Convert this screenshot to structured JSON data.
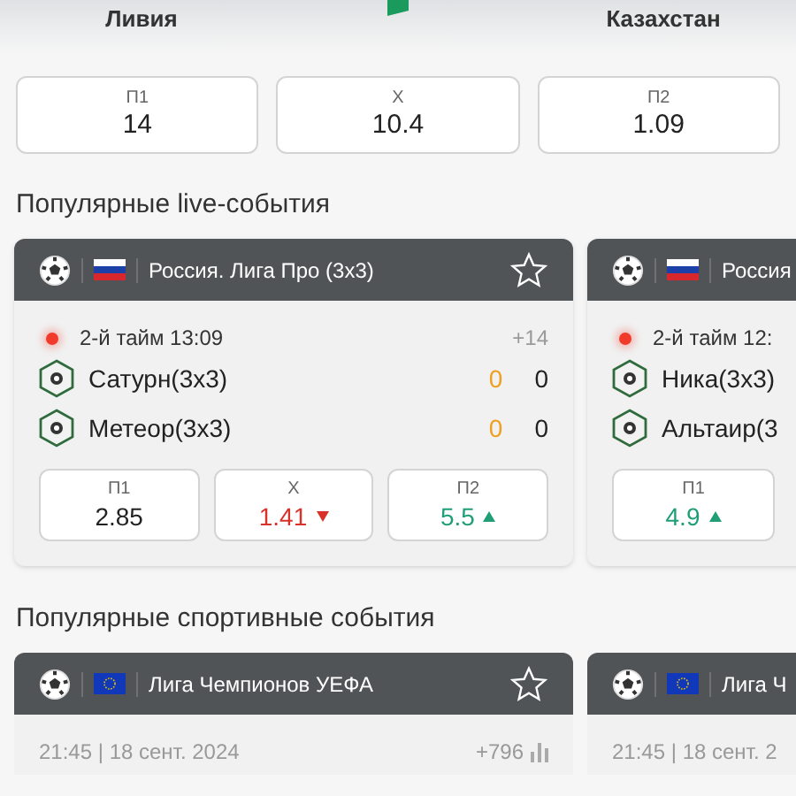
{
  "match": {
    "team1": "Ливия",
    "team2": "Казахстан",
    "odds": [
      {
        "label": "П1",
        "value": "14",
        "up": false,
        "down": false
      },
      {
        "label": "Х",
        "value": "10.4",
        "up": false,
        "down": false
      },
      {
        "label": "П2",
        "value": "1.09",
        "up": false,
        "down": false
      }
    ]
  },
  "live_section": {
    "title": "Популярные live-события",
    "events": [
      {
        "league": "Россия. Лига Про (3х3)",
        "flag": {
          "kind": "russia"
        },
        "favorite": false,
        "period": "2-й тайм 13:09",
        "more": "+14",
        "teams": [
          {
            "name": "Сатурн(3х3)",
            "scores": [
              "0",
              "0"
            ]
          },
          {
            "name": "Метеор(3х3)",
            "scores": [
              "0",
              "0"
            ]
          }
        ],
        "odds": [
          {
            "label": "П1",
            "value": "2.85",
            "up": false,
            "down": false
          },
          {
            "label": "Х",
            "value": "1.41",
            "up": false,
            "down": true
          },
          {
            "label": "П2",
            "value": "5.5",
            "up": true,
            "down": false
          }
        ]
      },
      {
        "league": "Россия",
        "flag": {
          "kind": "russia"
        },
        "period": "2-й тайм 12:",
        "teams": [
          {
            "name": "Ника(3х3)"
          },
          {
            "name": "Альтаир(3"
          }
        ],
        "odds": [
          {
            "label": "П1",
            "value": "4.9",
            "up": true,
            "down": false
          }
        ]
      }
    ]
  },
  "sports_section": {
    "title": "Популярные спортивные события",
    "events": [
      {
        "league": "Лига Чемпионов УЕФА",
        "flag": {
          "kind": "eu"
        },
        "favorite": false,
        "date": "21:45 | 18 сент. 2024",
        "more": "+796"
      },
      {
        "league": "Лига Ч",
        "flag": {
          "kind": "eu"
        },
        "date": "21:45 | 18 сент. 2"
      }
    ]
  }
}
